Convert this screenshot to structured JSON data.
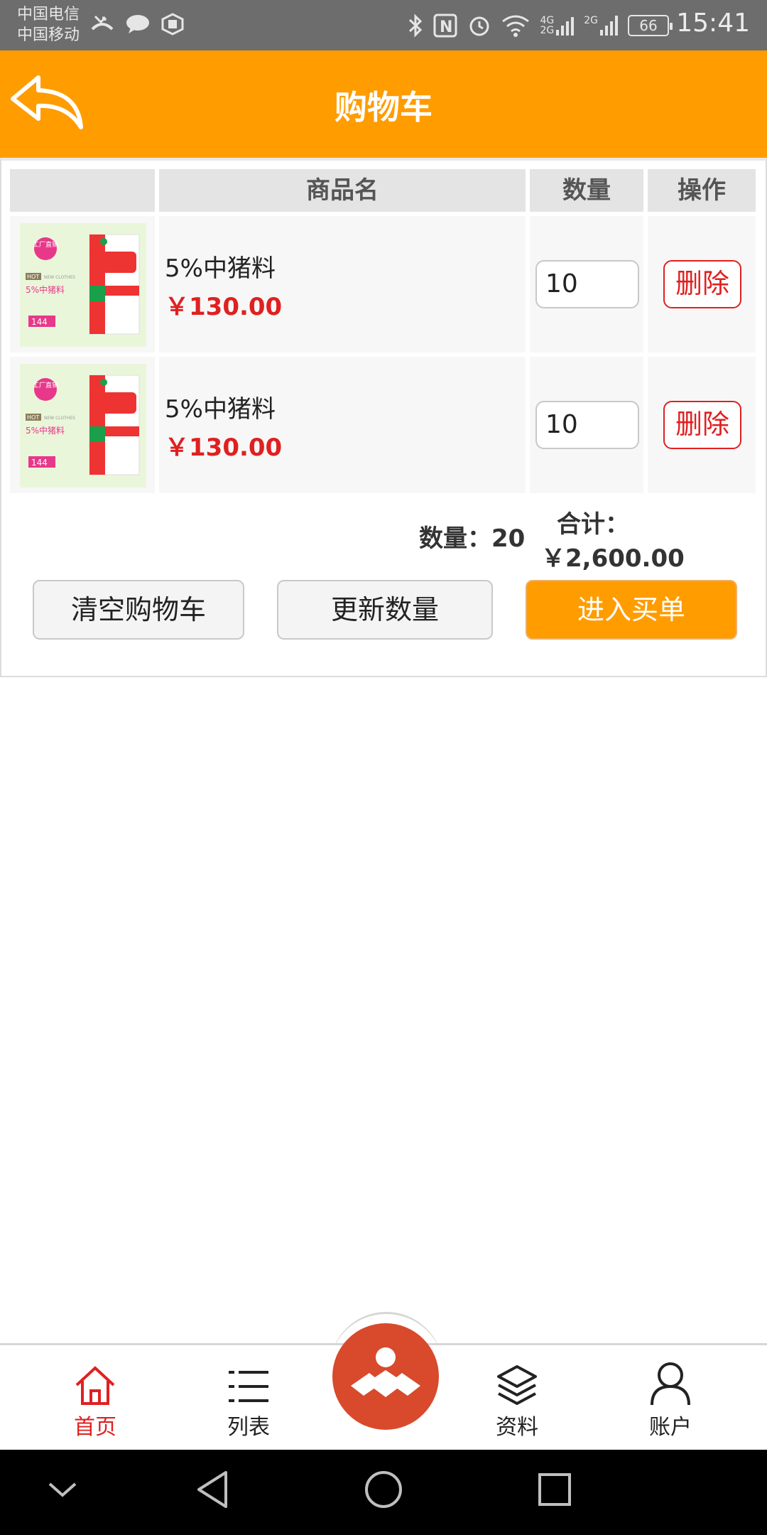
{
  "status_bar": {
    "carrier_1": "中国电信",
    "carrier_2": "中国移动",
    "signal_1": "4G",
    "signal_1b": "2G",
    "signal_2": "2G",
    "battery": "66",
    "time": "15:41"
  },
  "header": {
    "title": "购物车",
    "back_icon": "back-arrow-icon",
    "color": "#ff9c00"
  },
  "cart": {
    "columns": [
      "",
      "商品名",
      "数量",
      "操作"
    ],
    "items": [
      {
        "name": "5%中猪料",
        "price": "￥130.00",
        "quantity": "10",
        "delete_label": "删除",
        "thumb_badge": "工厂直销",
        "thumb_tag": "HOT",
        "thumb_tag2": "NEW CLOTHES",
        "thumb_title": "5%中猪料",
        "thumb_price": "144"
      },
      {
        "name": "5%中猪料",
        "price": "￥130.00",
        "quantity": "10",
        "delete_label": "删除",
        "thumb_badge": "工厂直销",
        "thumb_tag": "HOT",
        "thumb_tag2": "NEW CLOTHES",
        "thumb_title": "5%中猪料",
        "thumb_price": "144"
      }
    ],
    "summary": {
      "quantity_text": "数量：20",
      "total_label": "合计：",
      "total_value": "￥2,600.00"
    },
    "buttons": {
      "clear": "清空购物车",
      "update": "更新数量",
      "checkout": "进入买单"
    }
  },
  "bottom_nav": {
    "items": [
      {
        "label": "首页",
        "icon": "home-icon",
        "active": true
      },
      {
        "label": "列表",
        "icon": "list-icon",
        "active": false
      },
      {
        "label": "资料",
        "icon": "layers-icon",
        "active": false
      },
      {
        "label": "账户",
        "icon": "user-icon",
        "active": false
      }
    ],
    "center_icon": "brand-logo-icon",
    "active_color": "#e02020"
  },
  "system_nav": [
    "chevron-down-icon",
    "back-triangle-icon",
    "home-circle-icon",
    "recents-square-icon"
  ],
  "colors": {
    "accent": "#ff9c00",
    "price": "#e02020",
    "logo_bg": "#d84a2b"
  }
}
